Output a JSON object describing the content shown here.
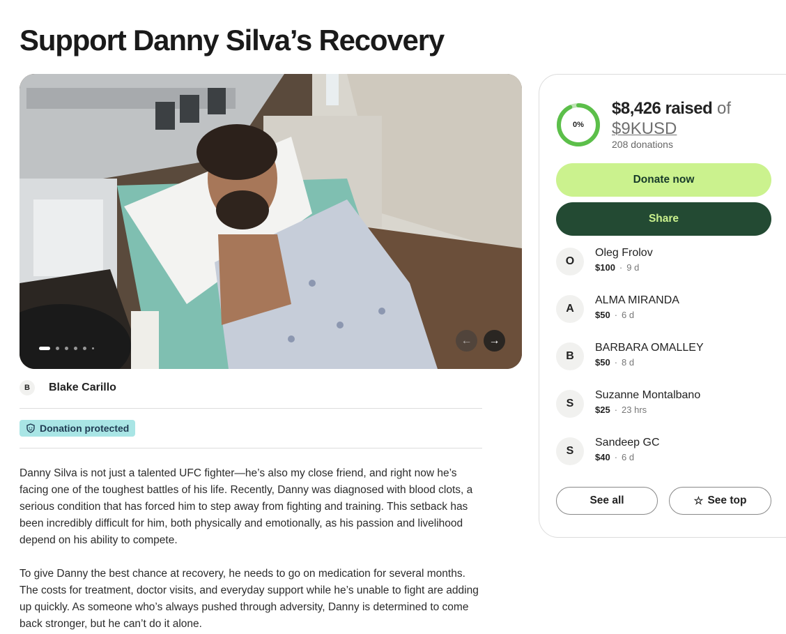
{
  "page": {
    "title": "Support Danny Silva’s Recovery"
  },
  "hero": {
    "slide_count": 6,
    "active_slide": 1,
    "prev_icon": "arrow-left-icon",
    "next_icon": "arrow-right-icon"
  },
  "organizer": {
    "initial": "B",
    "name": "Blake Carillo"
  },
  "badge": {
    "label": "Donation protected",
    "icon": "shield-icon",
    "color": "#a9e5e5"
  },
  "story": {
    "paragraphs": [
      "Danny Silva is not just a talented UFC fighter—he’s also my close friend, and right now he’s facing one of the toughest battles of his life. Recently, Danny was diagnosed with blood clots, a serious condition that has forced him to step away from fighting and training. This setback has been incredibly difficult for him, both physically and emotionally, as his passion and livelihood depend on his ability to compete.",
      "To give Danny the best chance at recovery, he needs to go on medication for several months. The costs for treatment, doctor visits, and everyday support while he’s unable to fight are adding up quickly. As someone who’s always pushed through adversity, Danny is determined to come back stronger, but he can’t do it alone."
    ]
  },
  "progress": {
    "percent_label": "0%",
    "raised": "$8,426 raised",
    "of": "of",
    "goal": "$9KUSD",
    "donations": "208 donations",
    "ring_color": "#5cbf4a"
  },
  "actions": {
    "donate": "Donate now",
    "share": "Share",
    "donate_color": "#cbf28e",
    "share_color": "#234a33"
  },
  "donors": [
    {
      "initial": "O",
      "name": "Oleg Frolov",
      "amount": "$100",
      "time": "9 d"
    },
    {
      "initial": "A",
      "name": "ALMA MIRANDA",
      "amount": "$50",
      "time": "6 d"
    },
    {
      "initial": "B",
      "name": "BARBARA OMALLEY",
      "amount": "$50",
      "time": "8 d"
    },
    {
      "initial": "S",
      "name": "Suzanne Montalbano",
      "amount": "$25",
      "time": "23 hrs"
    },
    {
      "initial": "S",
      "name": "Sandeep GC",
      "amount": "$40",
      "time": "6 d"
    }
  ],
  "donor_sep": "·",
  "footer_buttons": {
    "see_all": "See all",
    "see_top": "See top",
    "see_top_icon": "star-icon"
  }
}
